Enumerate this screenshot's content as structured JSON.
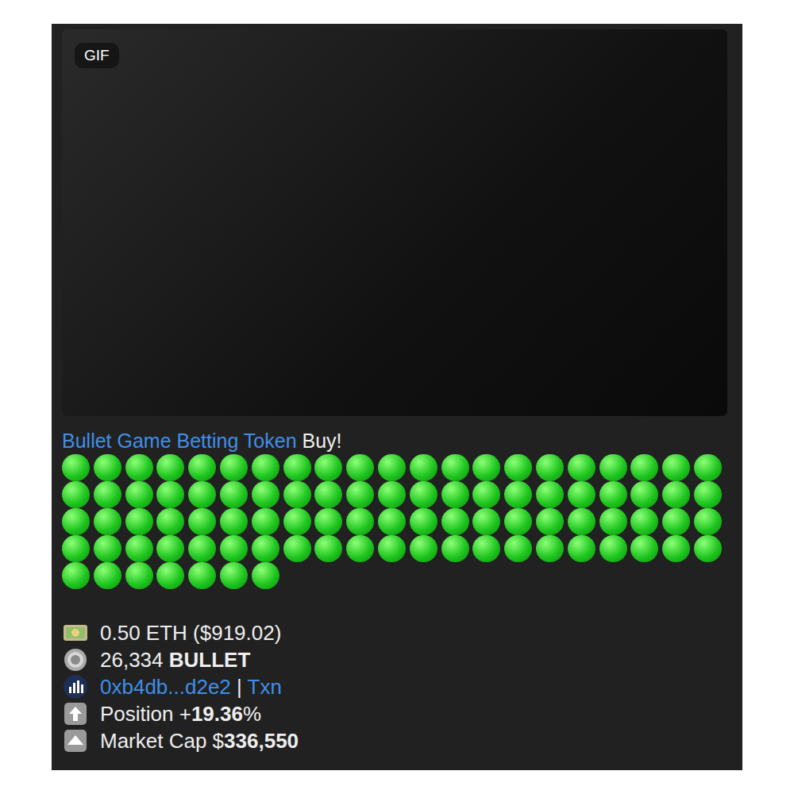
{
  "media": {
    "badge": "GIF"
  },
  "title": {
    "token": "Bullet Game Betting Token",
    "action": "Buy!"
  },
  "dots": {
    "count": 91,
    "color": "#1fc61f"
  },
  "stats": [
    {
      "kind": "money",
      "segments": [
        {
          "text": "0.50 ETH ($919.02)",
          "bold": false,
          "link": false
        }
      ]
    },
    {
      "kind": "coin",
      "segments": [
        {
          "text": "26,334 ",
          "bold": false,
          "link": false
        },
        {
          "text": "BULLET",
          "bold": true,
          "link": false
        }
      ]
    },
    {
      "kind": "wallet",
      "segments": [
        {
          "text": "0xb4db...d2e2",
          "bold": false,
          "link": true
        },
        {
          "text": " | ",
          "bold": false,
          "link": false
        },
        {
          "text": "Txn",
          "bold": false,
          "link": true
        }
      ]
    },
    {
      "kind": "position",
      "segments": [
        {
          "text": "Position +",
          "bold": false,
          "link": false
        },
        {
          "text": "19.36",
          "bold": true,
          "link": false
        },
        {
          "text": "%",
          "bold": false,
          "link": false
        }
      ]
    },
    {
      "kind": "marketcap",
      "segments": [
        {
          "text": "Market Cap $",
          "bold": false,
          "link": false
        },
        {
          "text": "336,550",
          "bold": true,
          "link": false
        }
      ]
    }
  ]
}
